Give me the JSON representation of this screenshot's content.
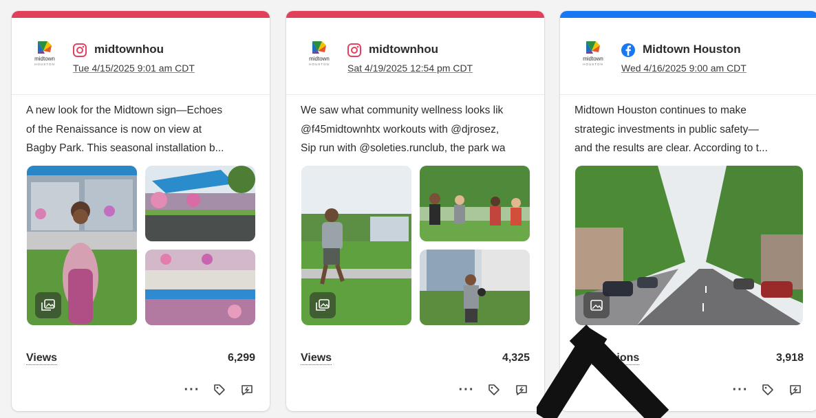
{
  "colors": {
    "instagram_bar": "#e0405a",
    "facebook_bar": "#1877f2",
    "instagram_icon": "#e4405f",
    "facebook_icon": "#1877f2"
  },
  "cards": [
    {
      "platform": "instagram",
      "platform_icon": "instagram-icon",
      "account": "midtownhou",
      "date": "Tue 4/15/2025 9:01 am CDT",
      "text": "A new look for the Midtown sign—Echoes\nof the Renaissance is now on view at\nBagby Park. This seasonal installation b...",
      "metric_label": "Views",
      "metric_value": "6,299"
    },
    {
      "platform": "instagram",
      "platform_icon": "instagram-icon",
      "account": "midtownhou",
      "date": "Sat 4/19/2025 12:54 pm CDT",
      "text": "We saw what community wellness looks lik\n@f45midtownhtx workouts with @djrosez,\nSip run with @soleties.runclub, the park wa",
      "metric_label": "Views",
      "metric_value": "4,325"
    },
    {
      "platform": "facebook",
      "platform_icon": "facebook-icon",
      "account": "Midtown Houston",
      "date": "Wed 4/16/2025 9:00 am CDT",
      "text": "Midtown Houston continues to make\nstrategic investments in public safety—\nand the results are clear. According to t...",
      "metric_label": "Impressions",
      "metric_value": "3,918"
    }
  ],
  "logo": {
    "line1": "midtown",
    "line2": "HOUSTON"
  },
  "actions": {
    "more": "···"
  }
}
